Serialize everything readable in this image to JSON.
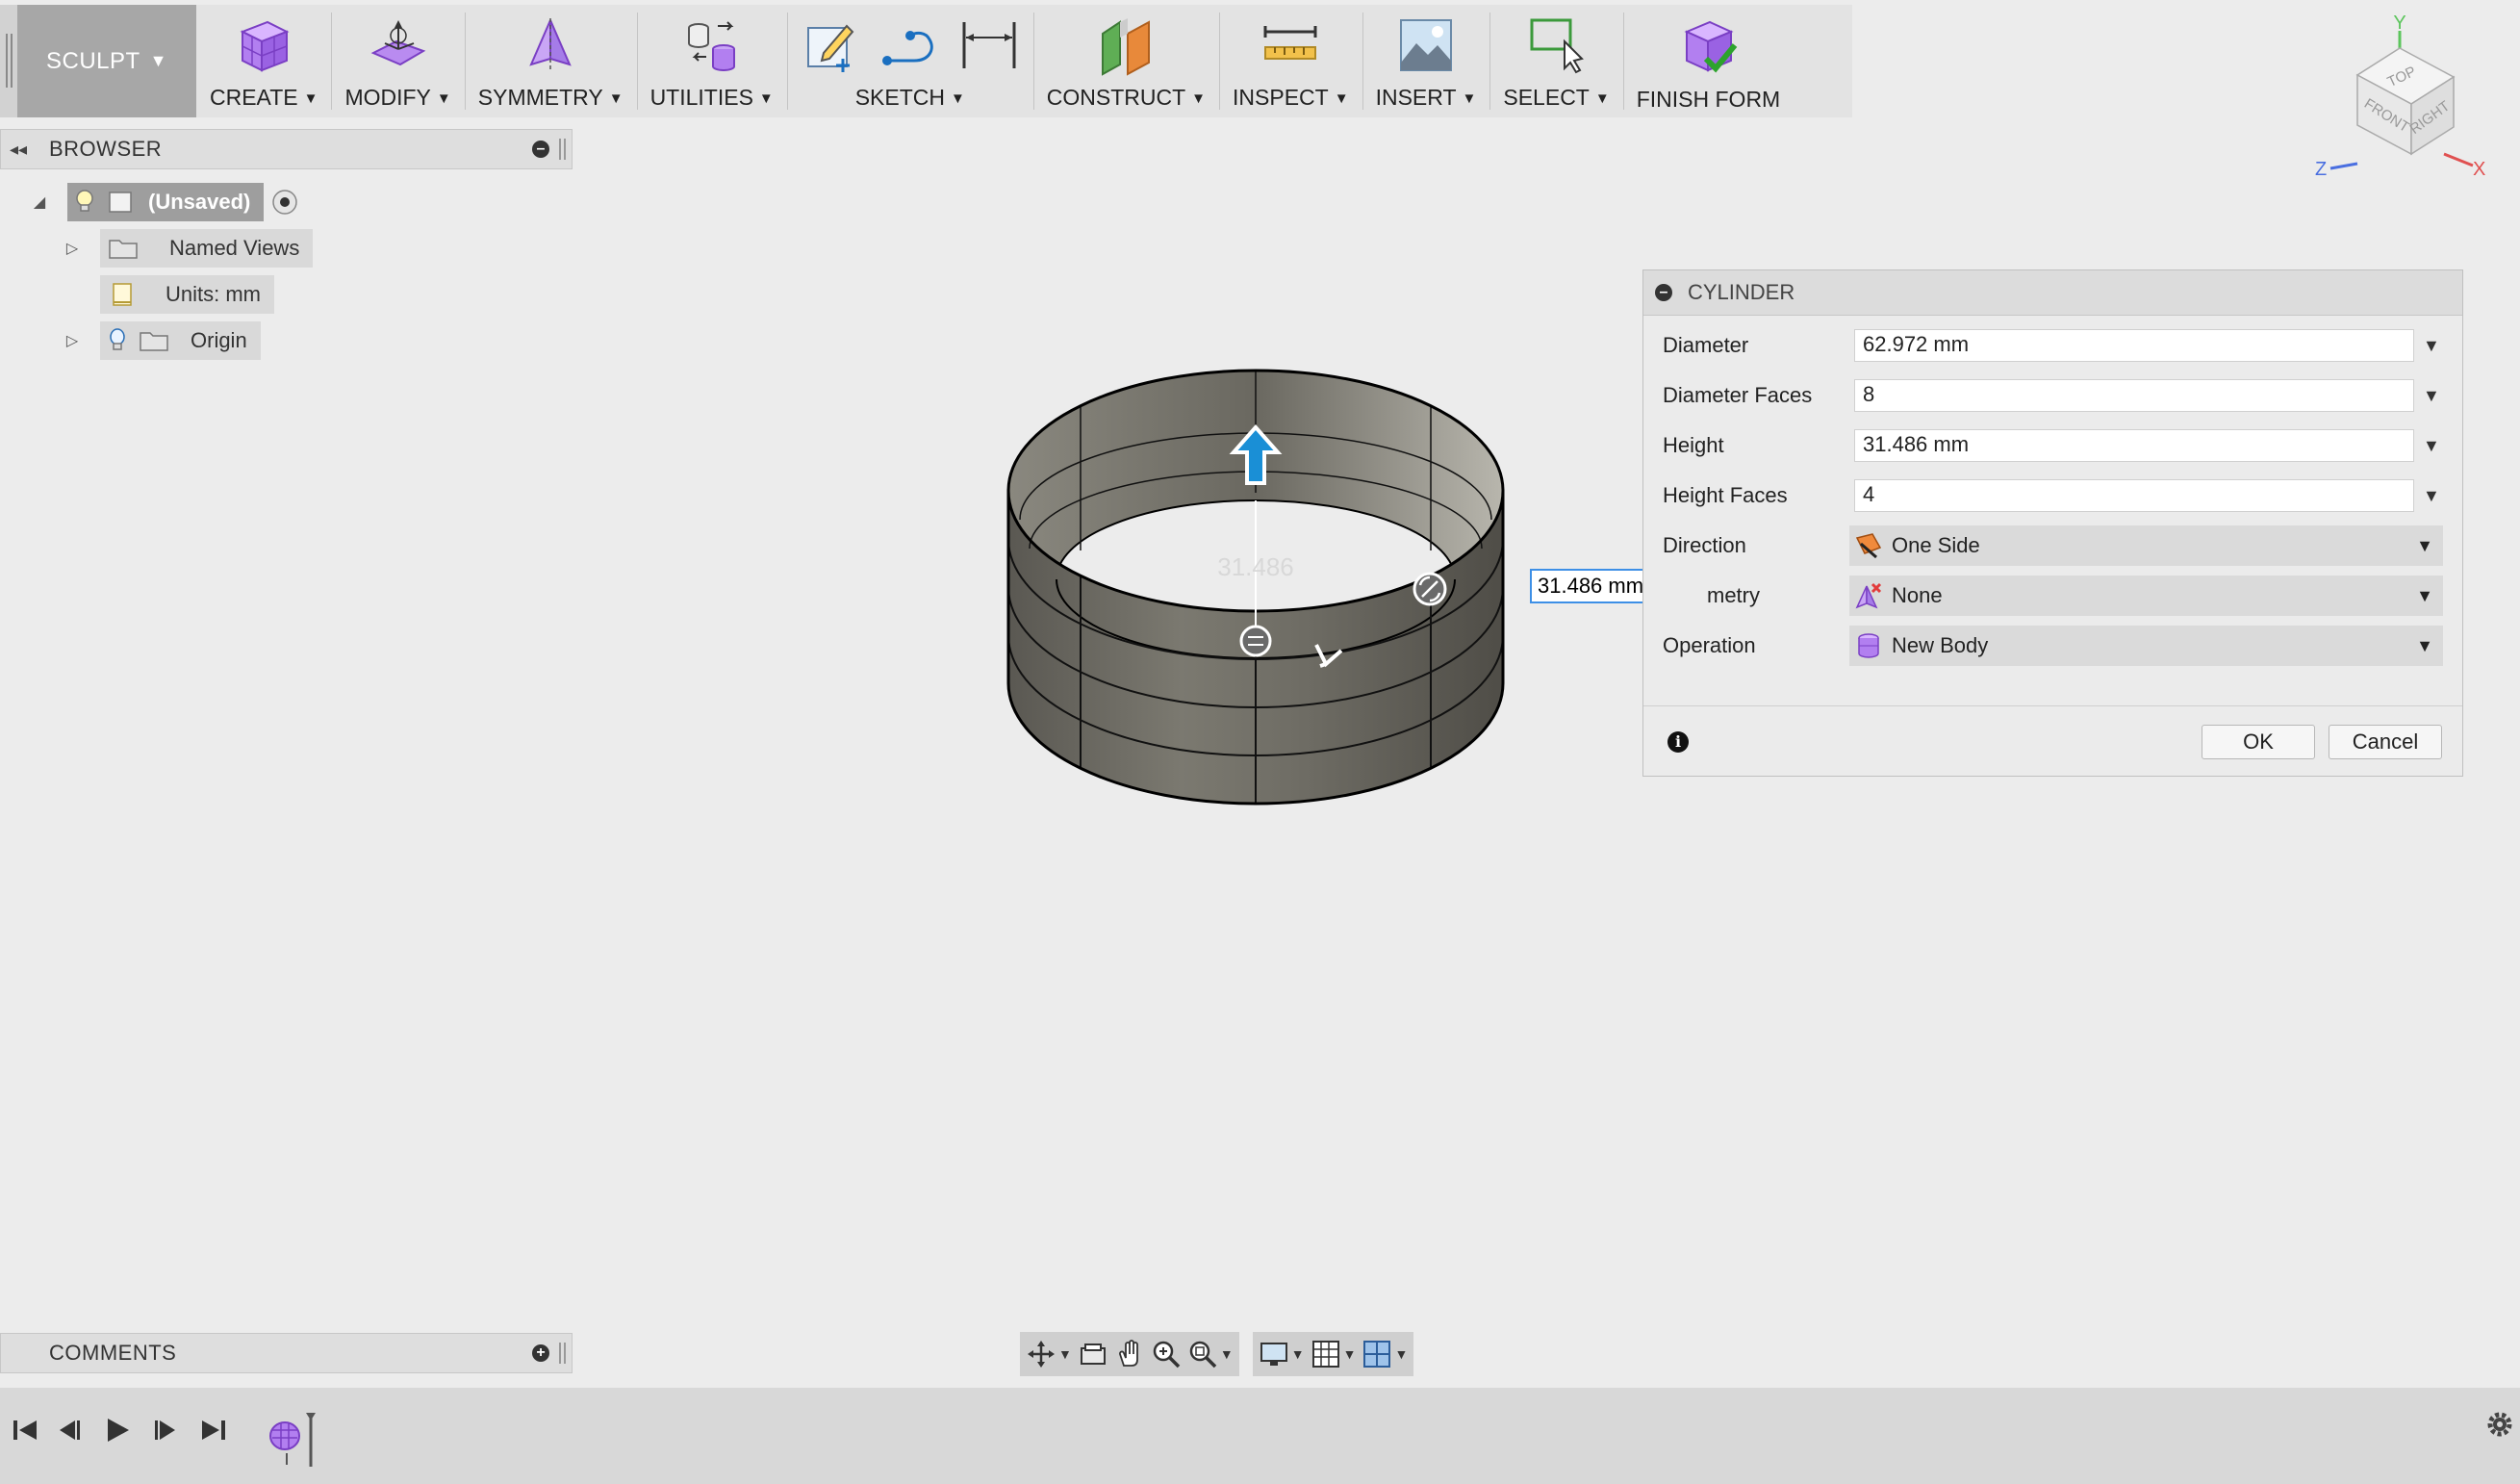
{
  "toolbar": {
    "workspace": "SCULPT",
    "groups": [
      {
        "label": "CREATE"
      },
      {
        "label": "MODIFY"
      },
      {
        "label": "SYMMETRY"
      },
      {
        "label": "UTILITIES"
      },
      {
        "label": "SKETCH"
      },
      {
        "label": "CONSTRUCT"
      },
      {
        "label": "INSPECT"
      },
      {
        "label": "INSERT"
      },
      {
        "label": "SELECT"
      },
      {
        "label": "FINISH FORM"
      }
    ]
  },
  "browser": {
    "title": "BROWSER",
    "root": "(Unsaved)",
    "items": [
      {
        "label": "Named Views"
      },
      {
        "label": "Units: mm"
      },
      {
        "label": "Origin"
      }
    ]
  },
  "comments": {
    "title": "COMMENTS"
  },
  "viewport": {
    "height_input_value": "31.486 mm",
    "dimension_label": "31.486"
  },
  "viewcube": {
    "faces": [
      "TOP",
      "FRONT",
      "RIGHT"
    ],
    "axes": [
      "Y",
      "Z",
      "X"
    ]
  },
  "dialog": {
    "title": "CYLINDER",
    "fields": [
      {
        "label": "Diameter",
        "value": "62.972 mm"
      },
      {
        "label": "Diameter Faces",
        "value": "8"
      },
      {
        "label": "Height",
        "value": "31.486 mm"
      },
      {
        "label": "Height Faces",
        "value": "4"
      }
    ],
    "selects": [
      {
        "label": "Direction",
        "value": "One Side"
      },
      {
        "label": "metry",
        "value": "None"
      },
      {
        "label": "Operation",
        "value": "New Body"
      }
    ],
    "ok_label": "OK",
    "cancel_label": "Cancel"
  },
  "colors": {
    "accent_blue": "#1a8fd6",
    "sculpt_purple": "#a67be8",
    "cylinder_fill": "#707070"
  }
}
